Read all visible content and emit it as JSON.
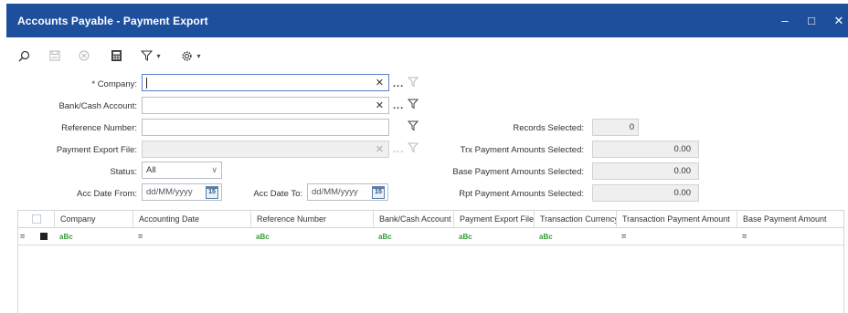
{
  "window": {
    "title": "Accounts Payable - Payment Export",
    "minimize_glyph": "‒",
    "maximize_glyph": "□",
    "close_glyph": "✕"
  },
  "toolbar": {
    "icons": [
      "search-icon",
      "save-icon",
      "cancel-icon",
      "calculator-icon",
      "filter-icon",
      "settings-icon"
    ],
    "caret": "▾"
  },
  "form": {
    "company": {
      "label": "* Company:",
      "value": ""
    },
    "bank_cash_account": {
      "label": "Bank/Cash Account:",
      "value": ""
    },
    "reference_number": {
      "label": "Reference Number:",
      "value": ""
    },
    "payment_export_file": {
      "label": "Payment Export File:",
      "value": ""
    },
    "status": {
      "label": "Status:",
      "value": "All"
    },
    "acc_date_from": {
      "label": "Acc Date From:",
      "placeholder": "dd/MM/yyyy"
    },
    "acc_date_to": {
      "label": "Acc Date To:",
      "placeholder": "dd/MM/yyyy"
    },
    "calendar_day": "15",
    "clear_glyph": "✕",
    "ellipsis": "...",
    "dropdown_glyph": "∨"
  },
  "summary": {
    "records_selected": {
      "label": "Records Selected:",
      "value": "0"
    },
    "trx_payment_amounts": {
      "label": "Trx Payment Amounts Selected:",
      "value": "0.00"
    },
    "base_payment_amounts": {
      "label": "Base Payment Amounts Selected:",
      "value": "0.00"
    },
    "rpt_payment_amounts": {
      "label": "Rpt Payment Amounts Selected:",
      "value": "0.00"
    }
  },
  "grid": {
    "columns": [
      "Company",
      "Accounting Date",
      "Reference Number",
      "Bank/Cash Account",
      "Payment Export File",
      "Transaction Currency",
      "Transaction Payment Amount",
      "Base Payment Amount"
    ],
    "filter_row": {
      "row_op": "=",
      "ops": [
        "aBc",
        "=",
        "aBc",
        "aBc",
        "aBc",
        "aBc",
        "=",
        "="
      ]
    }
  },
  "colors": {
    "titlebar": "#1d4f9c",
    "border": "#b8bfc8",
    "focus_border": "#5a80c4",
    "filter_green": "#3a9a3a"
  }
}
